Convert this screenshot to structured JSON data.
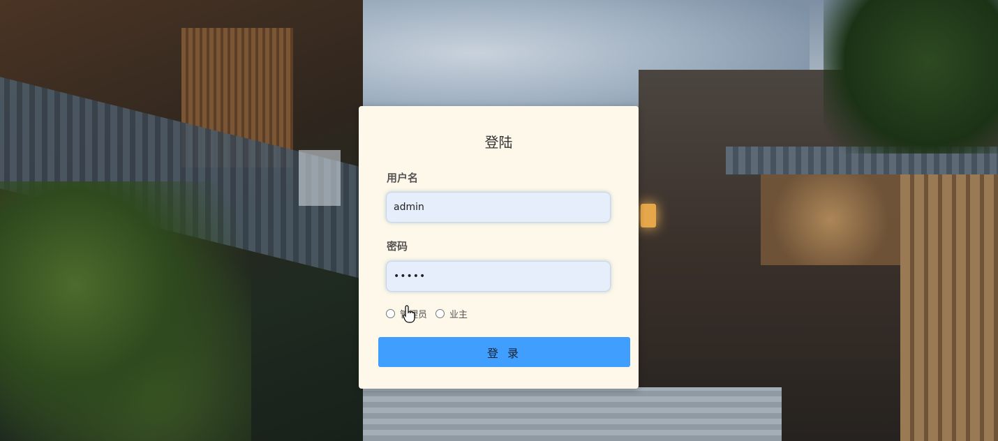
{
  "login": {
    "title": "登陆",
    "username_label": "用户名",
    "username_value": "admin",
    "password_label": "密码",
    "password_value": "•••••",
    "roles": [
      {
        "label": "管理员",
        "selected": false
      },
      {
        "label": "业主",
        "selected": false
      }
    ],
    "submit_label": "登 录"
  },
  "colors": {
    "card_bg": "#fdf8e9",
    "button_bg": "#409eff",
    "input_bg": "#e6eefb"
  }
}
